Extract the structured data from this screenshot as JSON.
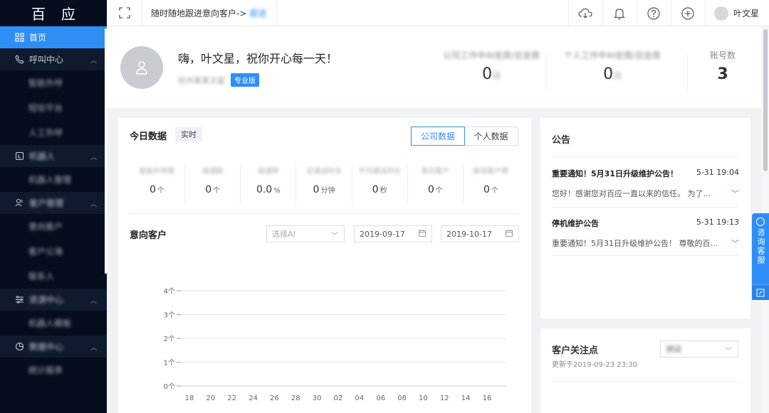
{
  "sidebar": {
    "logo": "百应",
    "items": [
      {
        "label": "首页"
      },
      {
        "label": "呼叫中心"
      },
      {
        "label": "智能外呼"
      },
      {
        "label": "短信平台"
      },
      {
        "label": "人工外呼"
      },
      {
        "label": "机器人"
      },
      {
        "label": "机器人管理"
      },
      {
        "label": "客户管理"
      },
      {
        "label": "意向客户"
      },
      {
        "label": "客户公海"
      },
      {
        "label": "联系人"
      },
      {
        "label": "资源中心"
      },
      {
        "label": "机器人模板"
      },
      {
        "label": "数据中心"
      },
      {
        "label": "统计报表"
      }
    ]
  },
  "topbar": {
    "breadcrumb_text": "随时随地跟进意向客户->",
    "breadcrumb_link": "跟进",
    "user_name": "叶文星"
  },
  "welcome": {
    "greeting": "嗨，叶文星，祝你开心每一天！",
    "company_name": "杭州某某文星",
    "badge": "专业版",
    "stats": [
      {
        "label": "公司工作中AI坐席/总坐席",
        "value": "0",
        "suffix": "/0"
      },
      {
        "label": "个人工作中AI坐席/总坐席",
        "value": "0",
        "suffix": "/0"
      },
      {
        "label": "账号数",
        "value": "3",
        "suffix": ""
      }
    ]
  },
  "today": {
    "title": "今日数据",
    "tag": "实时",
    "tabs": [
      "公司数据",
      "个人数据"
    ],
    "metrics": [
      {
        "label": "智能外呼数",
        "value": "0",
        "unit": "个"
      },
      {
        "label": "接通数",
        "value": "0",
        "unit": "个"
      },
      {
        "label": "接通率",
        "value": "0.0",
        "unit": "%"
      },
      {
        "label": "总通话时长",
        "value": "0",
        "unit": "分钟"
      },
      {
        "label": "平均通话时长",
        "value": "0",
        "unit": "秒"
      },
      {
        "label": "意向客户",
        "value": "0",
        "unit": "个"
      },
      {
        "label": "新增客户数",
        "value": "0",
        "unit": "个"
      }
    ]
  },
  "intent": {
    "title": "意向客户",
    "select_placeholder": "选择AI",
    "date_start": "2019-09-17",
    "date_end": "2019-10-17"
  },
  "chart_data": {
    "type": "line",
    "x": [
      "18",
      "20",
      "22",
      "24",
      "26",
      "28",
      "30",
      "02",
      "04",
      "06",
      "08",
      "10",
      "12",
      "14",
      "16"
    ],
    "yticks": [
      "0个",
      "1个",
      "2个",
      "3个",
      "4个"
    ],
    "ylim": [
      0,
      4
    ],
    "series": []
  },
  "notice": {
    "title": "公告",
    "items": [
      {
        "title": "重要通知！5月31日升级维护公告！",
        "time": "5-31 19:04",
        "body": "您好！感谢您对百应一直以来的信任。 为了..."
      },
      {
        "title": "停机维护公告",
        "time": "5-31 19:13",
        "body": "重要通知！5月31日升级维护公告！ 尊敬的百..."
      }
    ]
  },
  "focus": {
    "title": "客户关注点",
    "updated": "更新于2019-09-23 23:30",
    "select_value": "测试"
  },
  "float_service": {
    "label": "咨询客服"
  },
  "colors": {
    "accent": "#2f8ef5",
    "sidebar_bg": "#060d1c"
  }
}
